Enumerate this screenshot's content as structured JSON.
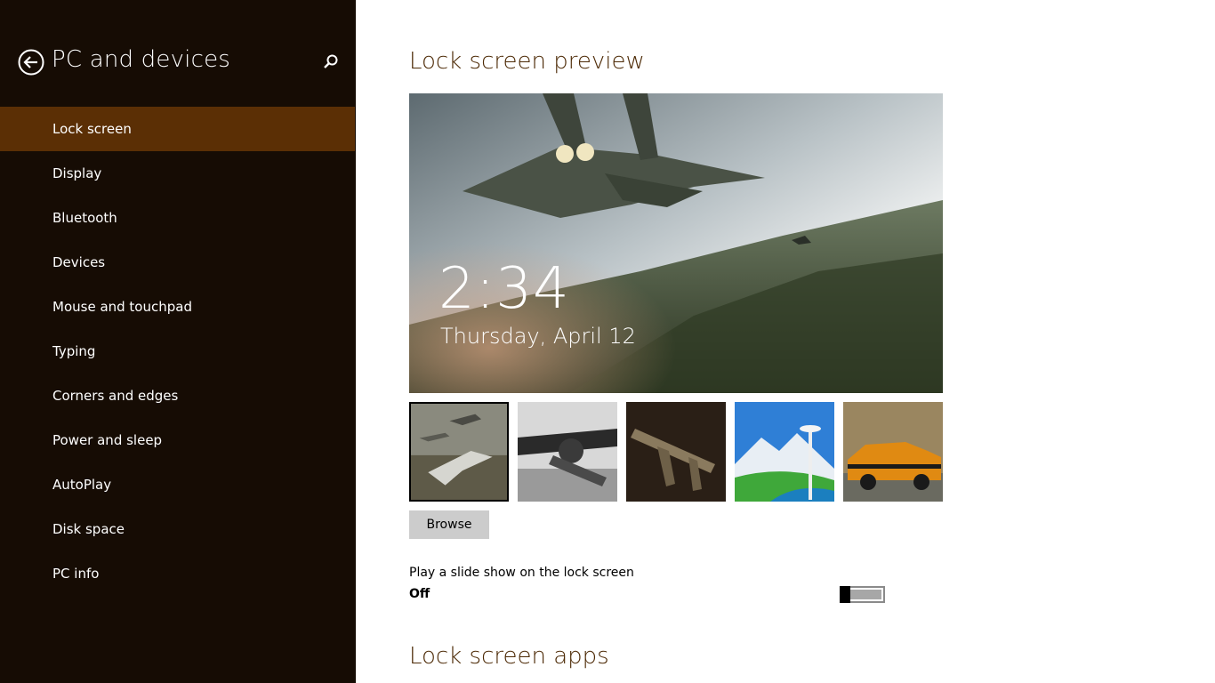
{
  "sidebar": {
    "title": "PC and devices",
    "back_icon": "back-arrow-circle-icon",
    "search_icon": "search-icon",
    "items": [
      {
        "label": "Lock screen",
        "active": true
      },
      {
        "label": "Display"
      },
      {
        "label": "Bluetooth"
      },
      {
        "label": "Devices"
      },
      {
        "label": "Mouse and touchpad"
      },
      {
        "label": "Typing"
      },
      {
        "label": "Corners and edges"
      },
      {
        "label": "Power and sleep"
      },
      {
        "label": "AutoPlay"
      },
      {
        "label": "Disk space"
      },
      {
        "label": "PC info"
      }
    ]
  },
  "main": {
    "preview_heading": "Lock screen preview",
    "preview": {
      "time": "2:34",
      "date": "Thursday, April 12"
    },
    "thumbnails": [
      {
        "name": "fighter-jets-thumbnail",
        "selected": true
      },
      {
        "name": "soldier-rifle-thumbnail",
        "selected": false
      },
      {
        "name": "assault-rifle-thumbnail",
        "selected": false
      },
      {
        "name": "space-needle-thumbnail",
        "selected": false
      },
      {
        "name": "orange-muscle-car-thumbnail",
        "selected": false
      }
    ],
    "browse_label": "Browse",
    "slideshow": {
      "label": "Play a slide show on the lock screen",
      "state_label": "Off",
      "on": false
    },
    "apps_heading": "Lock screen apps"
  },
  "colors": {
    "sidebar_bg": "#160c04",
    "active_item_bg": "#5b2f05",
    "heading_text": "#4d2a06"
  }
}
